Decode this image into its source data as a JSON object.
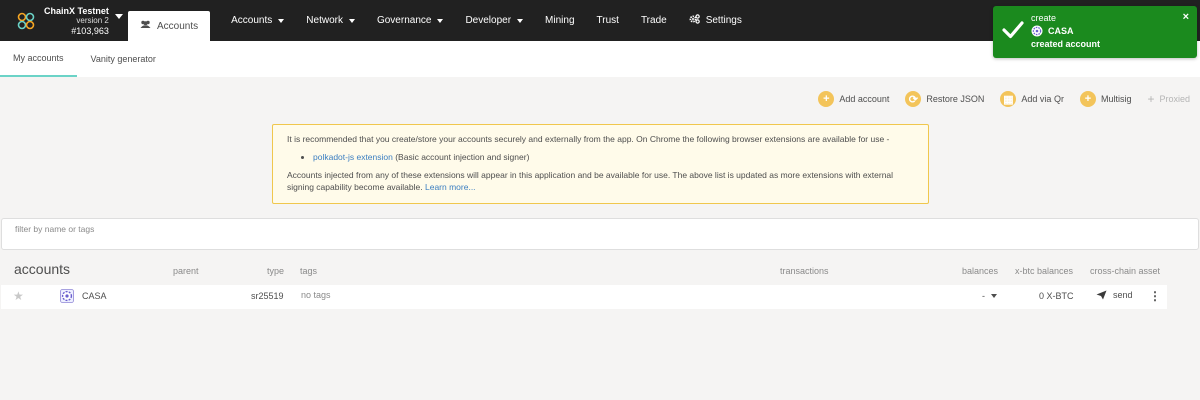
{
  "chain": {
    "name": "ChainX Testnet",
    "version": "version 2",
    "block": "#103,963"
  },
  "nav": {
    "active": {
      "label": "Accounts",
      "icon": "users-icon"
    },
    "items": [
      {
        "label": "Accounts",
        "dropdown": true
      },
      {
        "label": "Network",
        "dropdown": true
      },
      {
        "label": "Governance",
        "dropdown": true
      },
      {
        "label": "Developer",
        "dropdown": true
      },
      {
        "label": "Mining",
        "dropdown": false
      },
      {
        "label": "Trust",
        "dropdown": false
      },
      {
        "label": "Trade",
        "dropdown": false
      },
      {
        "label": "Settings",
        "dropdown": false,
        "icon": "gears-icon"
      }
    ]
  },
  "subtabs": [
    {
      "label": "My accounts",
      "active": true
    },
    {
      "label": "Vanity generator",
      "active": false
    }
  ],
  "actions": [
    {
      "label": "Add account",
      "symbol": "+",
      "disabled": false
    },
    {
      "label": "Restore JSON",
      "symbol": "⟳",
      "disabled": false
    },
    {
      "label": "Add via Qr",
      "symbol": "▦",
      "disabled": false
    },
    {
      "label": "Multisig",
      "symbol": "+",
      "disabled": false
    },
    {
      "label": "Proxied",
      "symbol": "+",
      "disabled": true
    }
  ],
  "notice": {
    "intro": "It is recommended that you create/store your accounts securely and externally from the app. On Chrome the following browser extensions are available for use -",
    "extension_link": "polkadot-js extension",
    "extension_desc": " (Basic account injection and signer)",
    "outro": "Accounts injected from any of these extensions will appear in this application and be available for use. The above list is updated as more extensions with external signing capability become available. ",
    "learn_more": "Learn more..."
  },
  "filter": {
    "placeholder": "filter by name or tags"
  },
  "table": {
    "title": "accounts",
    "headers": {
      "parent": "parent",
      "type": "type",
      "tags": "tags",
      "transactions": "transactions",
      "balances": "balances",
      "xbtc": "x-btc balances",
      "crosschain": "cross-chain asset"
    },
    "rows": [
      {
        "name": "CASA",
        "type": "sr25519",
        "tags": "no tags",
        "balance": "-",
        "xbtc": "0 X-BTC",
        "send_label": "send"
      }
    ]
  },
  "toast": {
    "action": "create",
    "account": "CASA",
    "message": "created account",
    "color": "#1b8a1e",
    "close": "×"
  },
  "colors": {
    "nav_bg": "#212121",
    "accent": "#f3c45a",
    "tab_underline": "#6bd3c7",
    "link": "#3b7ec1"
  }
}
